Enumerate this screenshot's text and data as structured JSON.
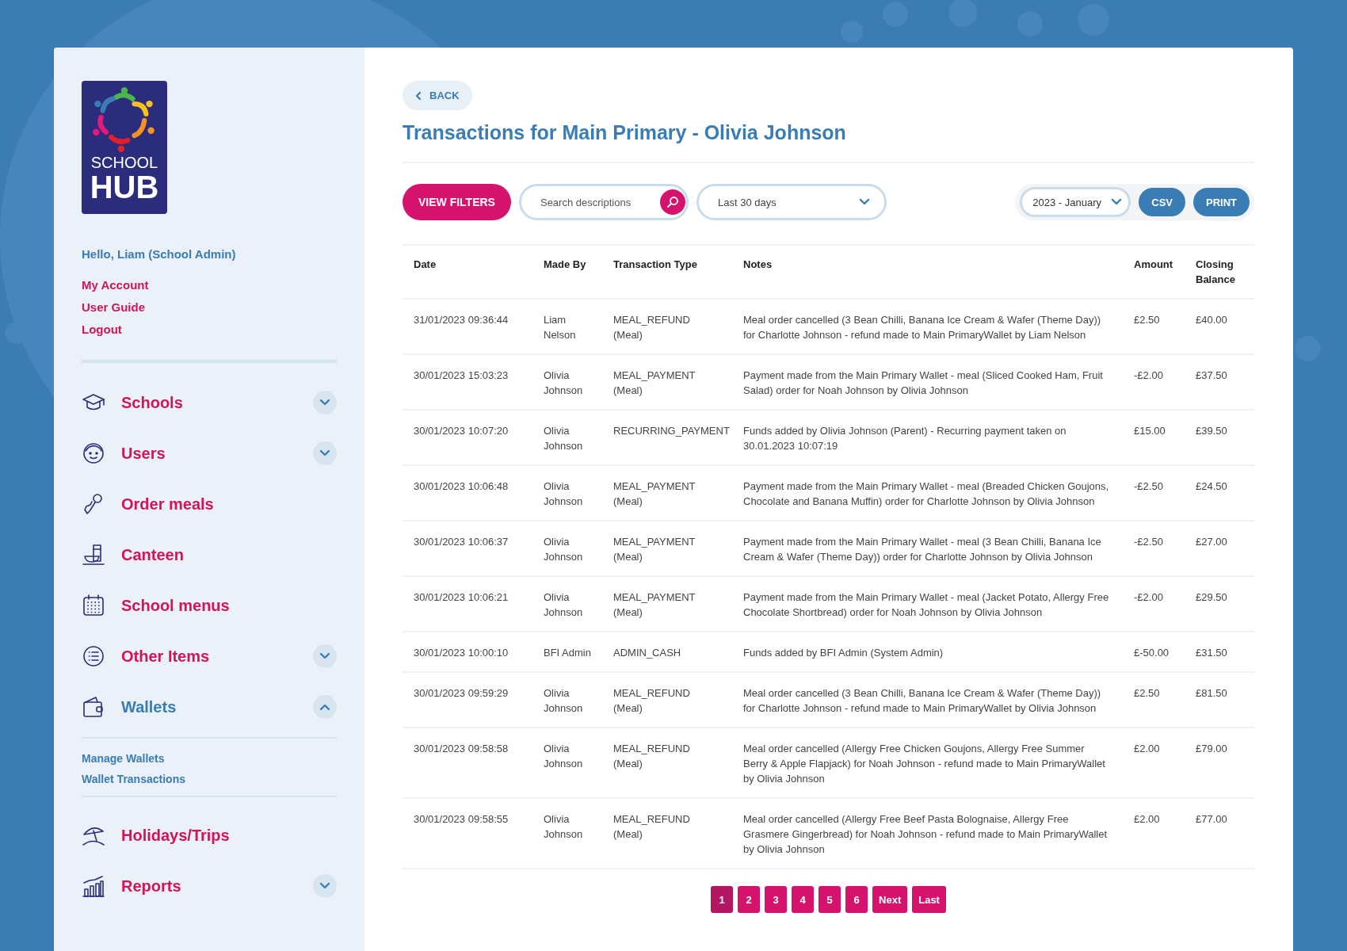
{
  "sidebar": {
    "logo": {
      "line_1": "SCHOOL",
      "line_2": "HUB"
    },
    "greeting": "Hello, Liam (School Admin)",
    "account_links": [
      "My Account",
      "User Guide",
      "Logout"
    ],
    "nav": [
      {
        "label": "Schools",
        "expanded": false
      },
      {
        "label": "Users",
        "expanded": false
      },
      {
        "label": "Order meals"
      },
      {
        "label": "Canteen"
      },
      {
        "label": "School menus"
      },
      {
        "label": "Other Items",
        "expanded": false
      },
      {
        "label": "Wallets",
        "expanded": true,
        "children": [
          "Manage Wallets",
          "Wallet Transactions"
        ]
      },
      {
        "label": "Holidays/Trips"
      },
      {
        "label": "Reports",
        "expanded": false
      }
    ]
  },
  "main": {
    "back": "BACK",
    "title": "Transactions for Main Primary - Olivia Johnson",
    "toolbar": {
      "filters_button": "VIEW FILTERS",
      "search": {
        "placeholder": "Search descriptions"
      },
      "range": "Last 30 days",
      "month": "2023 - January",
      "buttons": [
        "CSV",
        "PRINT"
      ]
    },
    "table": {
      "columns": [
        "Date",
        "Made By",
        "Transaction Type",
        "Notes",
        "Amount",
        "Closing Balance"
      ],
      "rows": [
        [
          "31/01/2023 09:36:44",
          "Liam Nelson",
          "MEAL_REFUND (Meal)",
          "Meal order cancelled (3 Bean Chilli, Banana Ice Cream & Wafer (Theme Day)) for Charlotte Johnson - refund made to Main PrimaryWallet by Liam Nelson",
          "£2.50",
          "£40.00"
        ],
        [
          "30/01/2023 15:03:23",
          "Olivia Johnson",
          "MEAL_PAYMENT (Meal)",
          "Payment made from the Main Primary Wallet - meal (Sliced Cooked Ham, Fruit Salad) order for Noah Johnson by Olivia Johnson",
          "-£2.00",
          "£37.50"
        ],
        [
          "30/01/2023 10:07:20",
          "Olivia Johnson",
          "RECURRING_PAYMENT",
          "Funds added by Olivia Johnson (Parent) - Recurring payment taken on 30.01.2023 10:07:19",
          "£15.00",
          "£39.50"
        ],
        [
          "30/01/2023 10:06:48",
          "Olivia Johnson",
          "MEAL_PAYMENT (Meal)",
          "Payment made from the Main Primary Wallet - meal (Breaded Chicken Goujons, Chocolate and Banana Muffin) order for Charlotte Johnson by Olivia Johnson",
          "-£2.50",
          "£24.50"
        ],
        [
          "30/01/2023 10:06:37",
          "Olivia Johnson",
          "MEAL_PAYMENT (Meal)",
          "Payment made from the Main Primary Wallet - meal (3 Bean Chilli, Banana Ice Cream & Wafer (Theme Day)) order for Charlotte Johnson by Olivia Johnson",
          "-£2.50",
          "£27.00"
        ],
        [
          "30/01/2023 10:06:21",
          "Olivia Johnson",
          "MEAL_PAYMENT (Meal)",
          "Payment made from the Main Primary Wallet - meal (Jacket Potato, Allergy Free Chocolate Shortbread) order for Noah Johnson by Olivia Johnson",
          "-£2.00",
          "£29.50"
        ],
        [
          "30/01/2023 10:00:10",
          "BFI Admin",
          "ADMIN_CASH",
          "Funds added by BFI Admin (System Admin)",
          "£-50.00",
          "£31.50"
        ],
        [
          "30/01/2023 09:59:29",
          "Olivia Johnson",
          "MEAL_REFUND (Meal)",
          "Meal order cancelled (3 Bean Chilli, Banana Ice Cream & Wafer (Theme Day)) for Charlotte Johnson - refund made to Main PrimaryWallet by Olivia Johnson",
          "£2.50",
          "£81.50"
        ],
        [
          "30/01/2023 09:58:58",
          "Olivia Johnson",
          "MEAL_REFUND (Meal)",
          "Meal order cancelled (Allergy Free Chicken Goujons, Allergy Free Summer Berry & Apple Flapjack) for Noah Johnson - refund made to Main PrimaryWallet by Olivia Johnson",
          "£2.00",
          "£79.00"
        ],
        [
          "30/01/2023 09:58:55",
          "Olivia Johnson",
          "MEAL_REFUND (Meal)",
          "Meal order cancelled (Allergy Free Beef Pasta Bolognaise, Allergy Free Grasmere Gingerbread) for Noah Johnson - refund made to Main PrimaryWallet by Olivia Johnson",
          "£2.00",
          "£77.00"
        ]
      ]
    },
    "pagination": [
      {
        "label": "1",
        "selected": true
      },
      {
        "label": "2",
        "selected": false
      },
      {
        "label": "3",
        "selected": false
      },
      {
        "label": "4",
        "selected": false
      },
      {
        "label": "5",
        "selected": false
      },
      {
        "label": "6",
        "selected": false
      },
      {
        "label": "Next",
        "selected": false
      },
      {
        "label": "Last",
        "selected": false
      }
    ]
  }
}
